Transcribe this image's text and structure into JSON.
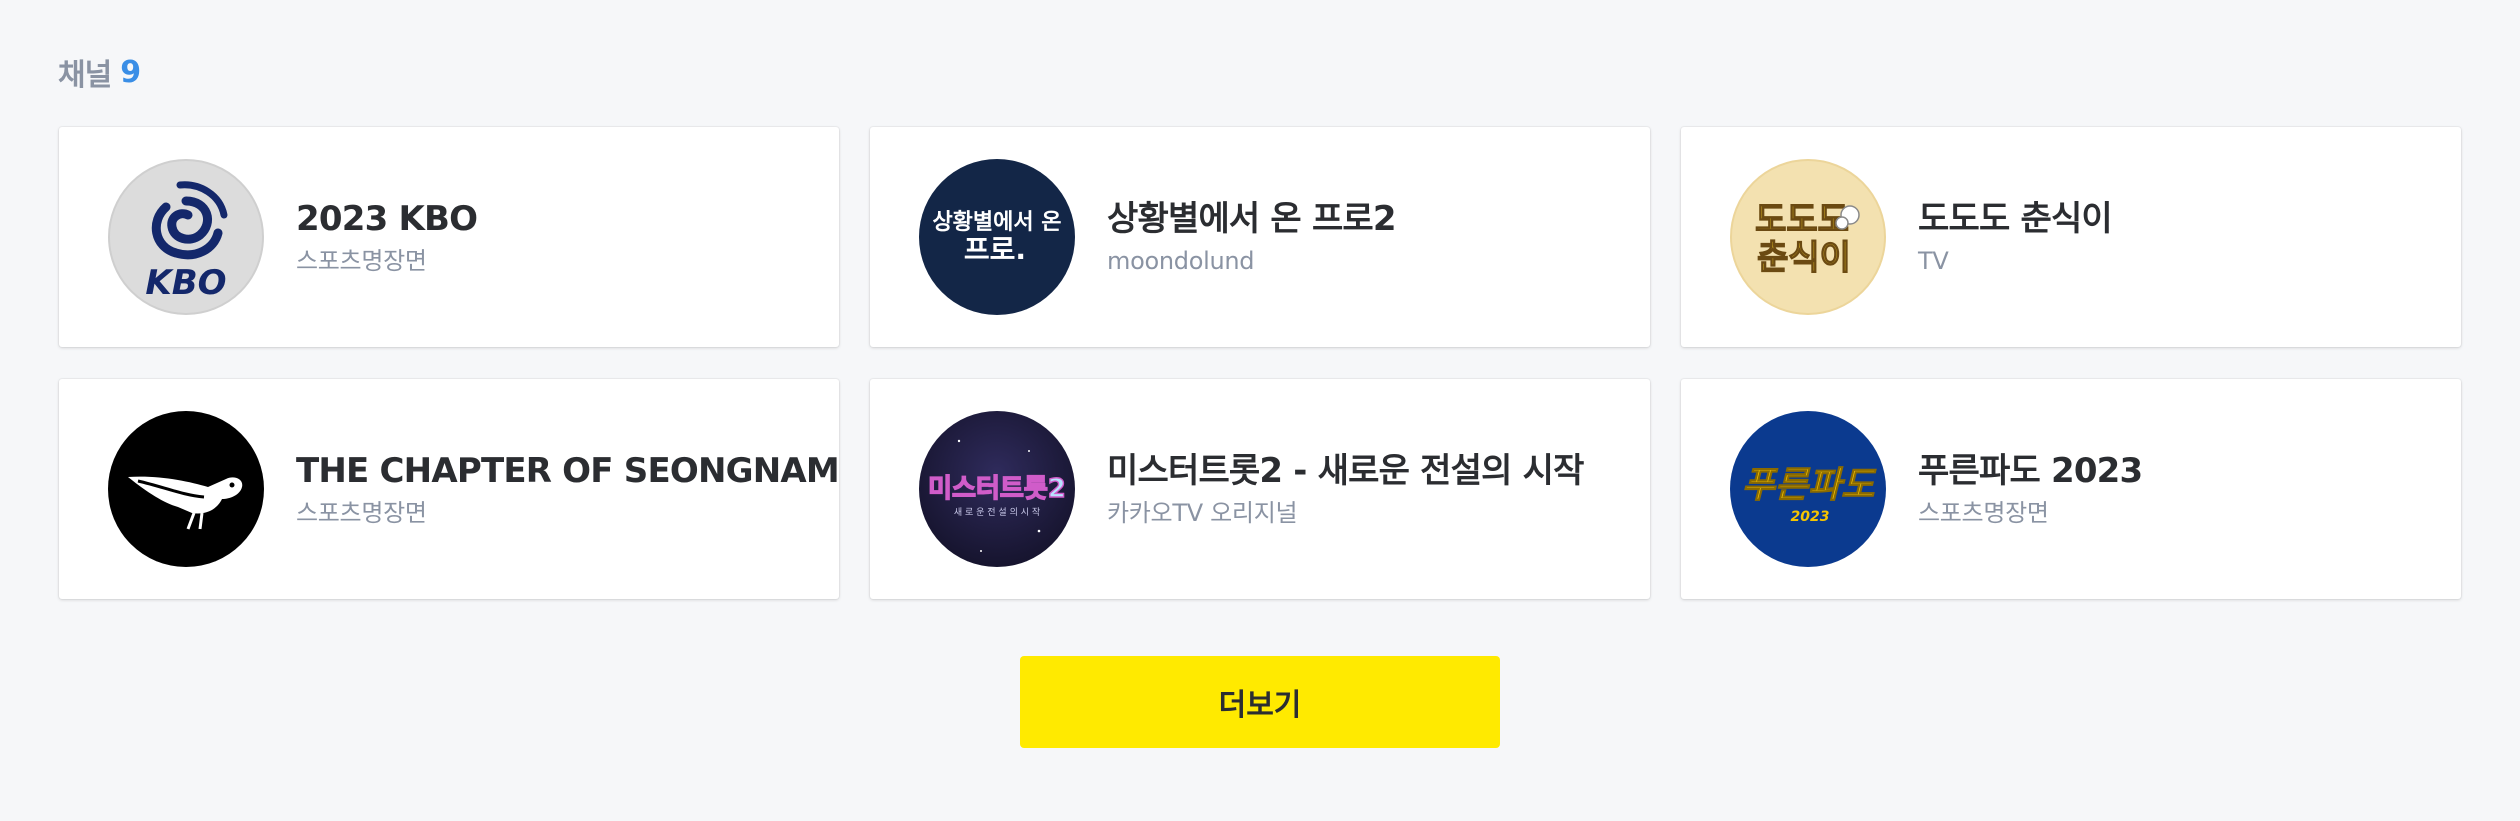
{
  "header": {
    "label": "채널",
    "count": "9"
  },
  "channels": [
    {
      "title": "2023 KBO",
      "subtitle": "스포츠명장면",
      "thumb_text": "KBO",
      "thumb_bg": "#dcdcdc",
      "icon": "kbo-logo-icon"
    },
    {
      "title": "상황별에서 온 프로2",
      "subtitle": "moondolund",
      "thumb_text": "상황별에서 온\n프로.",
      "thumb_bg": "#132647",
      "icon": "sanghwang-logo-icon"
    },
    {
      "title": "도도도 춘식이",
      "subtitle": "TV",
      "thumb_text": "도도도\n춘식이",
      "thumb_bg": "#f3e1b0",
      "icon": "dododo-logo-icon"
    },
    {
      "title": "THE CHAPTER OF SEONGNAM",
      "subtitle": "스포츠명장면",
      "thumb_bg": "#000000",
      "icon": "magpie-icon"
    },
    {
      "title": "미스터트롯2 - 새로운 전설의 시작",
      "subtitle": "카카오TV 오리지널",
      "thumb_text": "미스터트롯2",
      "thumb_bg": "#1c1a3a",
      "icon": "mistertrot-logo-icon"
    },
    {
      "title": "푸른파도 2023",
      "subtitle": "스포츠명장면",
      "thumb_text": "푸른파도",
      "thumb_year": "2023",
      "thumb_bg": "#0b3a8f",
      "icon": "pureunpado-logo-icon"
    }
  ],
  "more_button": {
    "label": "더보기",
    "color": "#ffea00"
  },
  "colors": {
    "background": "#f6f7f9",
    "accent": "#3a8ee6",
    "title": "#2b2d31",
    "subtitle": "#8a93a3"
  }
}
